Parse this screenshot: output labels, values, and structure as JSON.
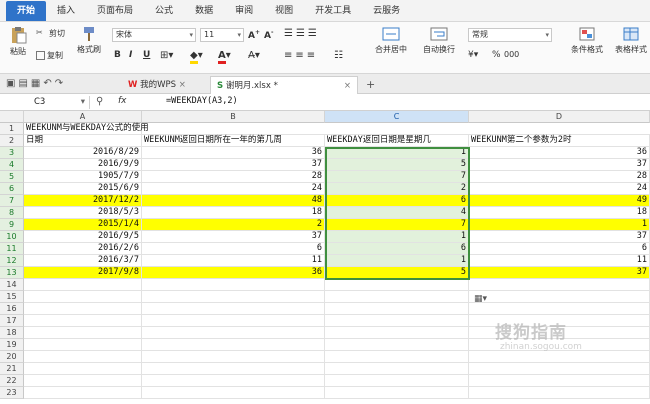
{
  "menu": [
    "开始",
    "插入",
    "页面布局",
    "公式",
    "数据",
    "审阅",
    "视图",
    "开发工具",
    "云服务"
  ],
  "ribbon": {
    "paste": "粘贴",
    "cut": "剪切",
    "copy": "复制",
    "format_painter": "格式刷",
    "font_name": "宋体",
    "font_size": "11",
    "merge_center": "合并居中",
    "wrap": "自动换行",
    "number_format": "常规",
    "pct": "%",
    "thousands": "000",
    "cond_format": "条件格式",
    "table_style": "表格样式"
  },
  "tabs": {
    "wps": "我的WPS",
    "file": "谢明月.xlsx *",
    "new": "+"
  },
  "formula_bar": {
    "cell": "C3",
    "fx": "fx",
    "formula": "=WEEKDAY(A3,2)"
  },
  "columns": [
    "A",
    "B",
    "C",
    "D"
  ],
  "rows": [
    "1",
    "2",
    "3",
    "4",
    "5",
    "6",
    "7",
    "8",
    "9",
    "10",
    "11",
    "12",
    "13",
    "14",
    "15",
    "16",
    "17",
    "18",
    "19",
    "20",
    "21",
    "22",
    "23"
  ],
  "table": {
    "title": "WEEKUNM与WEEKDAY公式的使用",
    "header": [
      "日期",
      "WEEKUNM返回日期所在一年的第几周",
      "WEEKDAY返回日期是星期几",
      "WEEKUNM第二个参数为2时"
    ],
    "data": [
      [
        "2016/8/29",
        "36",
        "1",
        "36"
      ],
      [
        "2016/9/9",
        "37",
        "5",
        "37"
      ],
      [
        "1905/7/9",
        "28",
        "7",
        "28"
      ],
      [
        "2015/6/9",
        "24",
        "2",
        "24"
      ],
      [
        "2017/12/2",
        "48",
        "6",
        "49"
      ],
      [
        "2018/5/3",
        "18",
        "4",
        "18"
      ],
      [
        "2015/1/4",
        "2",
        "7",
        "1"
      ],
      [
        "2016/9/5",
        "37",
        "1",
        "37"
      ],
      [
        "2016/2/6",
        "6",
        "6",
        "6"
      ],
      [
        "2016/3/7",
        "11",
        "1",
        "11"
      ],
      [
        "2017/9/8",
        "36",
        "5",
        "37"
      ]
    ],
    "highlighted_rows": [
      4,
      6,
      10
    ]
  },
  "watermark": {
    "text": "搜狗指南",
    "url": "zhinan.sogou.com"
  },
  "colors": {
    "accent": "#2f73c9",
    "highlight": "#ffff00",
    "selection": "#3f8f3f"
  }
}
